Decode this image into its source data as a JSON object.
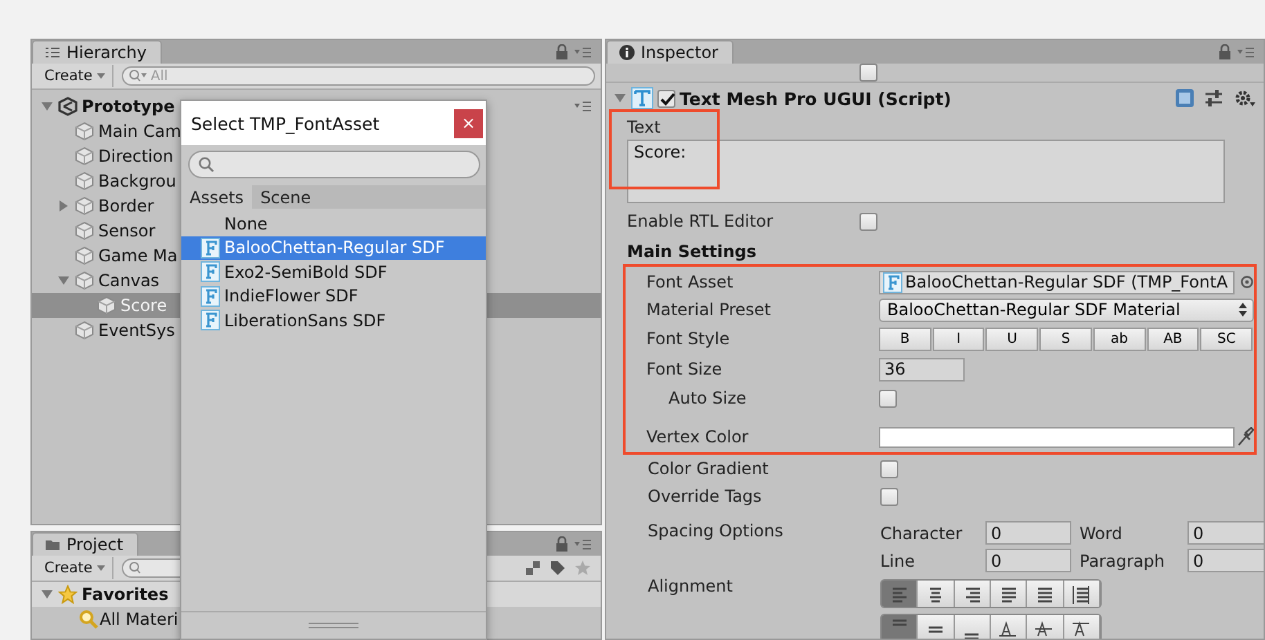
{
  "hierarchy": {
    "tab": "Hierarchy",
    "create": "Create",
    "search_placeholder": "All",
    "scene": {
      "label": "Prototype",
      "expanded": true,
      "children": [
        {
          "label": "Main Cam",
          "selected": false
        },
        {
          "label": "Direction",
          "selected": false
        },
        {
          "label": "Backgrou",
          "selected": false
        },
        {
          "label": "Border",
          "selected": false,
          "expanded": false
        },
        {
          "label": "Sensor",
          "selected": false
        },
        {
          "label": "Game Ma",
          "selected": false
        },
        {
          "label": "Canvas",
          "selected": false,
          "expanded": true,
          "children": [
            {
              "label": "Score",
              "selected": true
            }
          ]
        },
        {
          "label": "EventSys",
          "selected": false
        }
      ]
    }
  },
  "project": {
    "tab": "Project",
    "create": "Create",
    "favorites": {
      "label": "Favorites",
      "expanded": true,
      "children": [
        {
          "label": "All Materi"
        }
      ]
    }
  },
  "dialog": {
    "title": "Select TMP_FontAsset",
    "close": "×",
    "tabs": [
      {
        "label": "Assets",
        "selected": true
      },
      {
        "label": "Scene",
        "selected": false
      }
    ],
    "items": [
      {
        "kind": "none",
        "label": "None",
        "selected": false
      },
      {
        "kind": "font",
        "label": "BalooChettan-Regular SDF",
        "selected": true
      },
      {
        "kind": "font",
        "label": "Exo2-SemiBold SDF",
        "selected": false
      },
      {
        "kind": "font",
        "label": "IndieFlower SDF",
        "selected": false
      },
      {
        "kind": "font",
        "label": "LiberationSans SDF",
        "selected": false
      }
    ]
  },
  "inspector": {
    "tab": "Inspector",
    "cull_checked": false,
    "component": {
      "title": "Text Mesh Pro UGUI (Script)",
      "enabled": true,
      "expanded": true
    },
    "text_label": "Text",
    "text_value": "Score:",
    "rtl": {
      "label": "Enable RTL Editor",
      "checked": false
    },
    "section": "Main Settings",
    "font_asset": {
      "label": "Font Asset",
      "value": "BalooChettan-Regular SDF (TMP_FontA"
    },
    "material_preset": {
      "label": "Material Preset",
      "value": "BalooChettan-Regular SDF Material"
    },
    "font_style": {
      "label": "Font Style",
      "buttons": [
        {
          "label": "B",
          "selected": false
        },
        {
          "label": "I",
          "selected": false
        },
        {
          "label": "U",
          "selected": false
        },
        {
          "label": "S",
          "selected": false
        },
        {
          "label": "ab",
          "selected": false
        },
        {
          "label": "AB",
          "selected": false
        },
        {
          "label": "SC",
          "selected": false
        }
      ]
    },
    "font_size": {
      "label": "Font Size",
      "value": "36"
    },
    "auto_size": {
      "label": "Auto Size",
      "checked": false
    },
    "vertex_color": {
      "label": "Vertex Color",
      "color": "#ffffff"
    },
    "color_gradient": {
      "label": "Color Gradient",
      "checked": false
    },
    "override_tags": {
      "label": "Override Tags",
      "checked": false
    },
    "spacing": {
      "label": "Spacing Options",
      "fields": [
        {
          "label": "Character",
          "value": "0"
        },
        {
          "label": "Word",
          "value": "0"
        },
        {
          "label": "Line",
          "value": "0"
        },
        {
          "label": "Paragraph",
          "value": "0"
        }
      ]
    },
    "alignment": {
      "label": "Alignment",
      "rows": [
        [
          {
            "kind": "left",
            "selected": true
          },
          {
            "kind": "center",
            "selected": false
          },
          {
            "kind": "right",
            "selected": false
          },
          {
            "kind": "justified",
            "selected": false
          },
          {
            "kind": "flush",
            "selected": false
          },
          {
            "kind": "geometry",
            "selected": false
          }
        ],
        [
          {
            "kind": "top",
            "selected": true
          },
          {
            "kind": "middle",
            "selected": false
          },
          {
            "kind": "bottom",
            "selected": false
          },
          {
            "kind": "baseline",
            "selected": false
          },
          {
            "kind": "midline",
            "selected": false
          },
          {
            "kind": "capline",
            "selected": false
          }
        ]
      ]
    }
  }
}
